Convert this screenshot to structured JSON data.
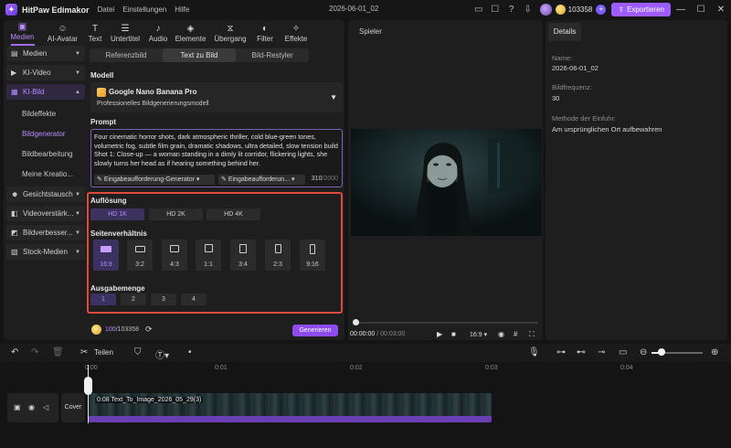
{
  "titlebar": {
    "app_name": "HitPaw Edimakor",
    "menu": [
      "Datei",
      "Einstellungen",
      "Hilfe"
    ],
    "doc_title": "2026-06-01_02",
    "credits": "103358",
    "export_label": "Exportieren"
  },
  "tools": {
    "tabs": [
      {
        "label": "Medien",
        "icon": "media-icon",
        "active": true
      },
      {
        "label": "AI-Avatar",
        "icon": "avatar-icon",
        "active": false
      },
      {
        "label": "Text",
        "icon": "text-icon",
        "active": false
      },
      {
        "label": "Untertitel",
        "icon": "subtitle-icon",
        "active": false
      },
      {
        "label": "Audio",
        "icon": "music-icon",
        "active": false
      },
      {
        "label": "Elemente",
        "icon": "elements-icon",
        "active": false
      },
      {
        "label": "Übergang",
        "icon": "transition-icon",
        "active": false
      },
      {
        "label": "Filter",
        "icon": "filter-icon",
        "active": false
      },
      {
        "label": "Effekte",
        "icon": "effects-icon",
        "active": false
      }
    ]
  },
  "sidebar": {
    "items": [
      {
        "label": "Medien",
        "icon": "folder-icon"
      },
      {
        "label": "KI-Video",
        "icon": "video-icon"
      },
      {
        "label": "KI-Bild",
        "icon": "image-icon",
        "active": true
      }
    ],
    "sub_items": [
      {
        "label": "Bildeffekte"
      },
      {
        "label": "Bildgenerator",
        "active": true
      },
      {
        "label": "Bildbearbeitung"
      },
      {
        "label": "Meine Kreatio..."
      }
    ],
    "more_items": [
      {
        "label": "Gesichtstausch",
        "icon": "face-swap-icon"
      },
      {
        "label": "Videoverstärk...",
        "icon": "enhance-icon"
      },
      {
        "label": "Bildverbesser...",
        "icon": "image-enhance-icon"
      },
      {
        "label": "Stock-Medien",
        "icon": "stock-icon"
      }
    ]
  },
  "generator": {
    "modes": [
      {
        "label": "Referenzbild"
      },
      {
        "label": "Text zu Bild",
        "active": true
      },
      {
        "label": "Bild-Restyler"
      }
    ],
    "model_label": "Modell",
    "model_name": "Google Nano Banana Pro",
    "model_desc": "Professionelles Bildgenerierungsmodell",
    "prompt_label": "Prompt",
    "prompt_text": "Four cinematic horror shots, dark atmospheric thriller, cold blue-green tones, volumetric fog, subtle film grain, dramatic shadows, ultra detailed, slow tension build Shot 1: Close-up — a woman standing in a dimly lit corridor, flickering lights, she slowly turns her head as if hearing something behind her.",
    "prompt_btn1": "Eingabeaufforderung-Generator",
    "prompt_btn2": "Eingabeaufforderun...",
    "char_count": "310",
    "char_max": "/2000",
    "resolution_label": "Auflösung",
    "resolutions": [
      {
        "label": "HD 1K",
        "active": true
      },
      {
        "label": "HD 2K"
      },
      {
        "label": "HD 4K"
      }
    ],
    "aspect_label": "Seitenverhältnis",
    "aspects": [
      {
        "label": "16:9",
        "active": true
      },
      {
        "label": "3:2"
      },
      {
        "label": "4:3"
      },
      {
        "label": "1:1"
      },
      {
        "label": "3:4"
      },
      {
        "label": "2:3"
      },
      {
        "label": "9:16"
      }
    ],
    "count_label": "Ausgabemenge",
    "counts": [
      {
        "label": "1",
        "active": true
      },
      {
        "label": "2"
      },
      {
        "label": "3"
      },
      {
        "label": "4"
      }
    ],
    "credit_cost": "100",
    "credit_total": "/103358",
    "generate_label": "Generieren"
  },
  "player": {
    "title": "Spieler",
    "time_current": "00:00:00",
    "time_total": "/ 00:03:00",
    "ratio": "16:9"
  },
  "details": {
    "tab": "Details",
    "name_label": "Name:",
    "name_value": "2026-06-01_02",
    "fps_label": "Bildfrequenz:",
    "fps_value": "30",
    "method_label": "Methode der Einfuhr:",
    "method_value": "Am ursprünglichen Ort aufbewahren"
  },
  "timeline": {
    "split_label": "Teilen",
    "ticks": [
      "0:00",
      "0:01",
      "0:02",
      "0:03",
      "0:04"
    ],
    "cover_label": "Cover",
    "clip_name": "0:08 Text_To_Image_2026_05_29(3)"
  },
  "colors": {
    "accent": "#9c5cff",
    "highlight_border": "#e04a3a",
    "background": "#141414",
    "panel": "#1e1e1e"
  }
}
